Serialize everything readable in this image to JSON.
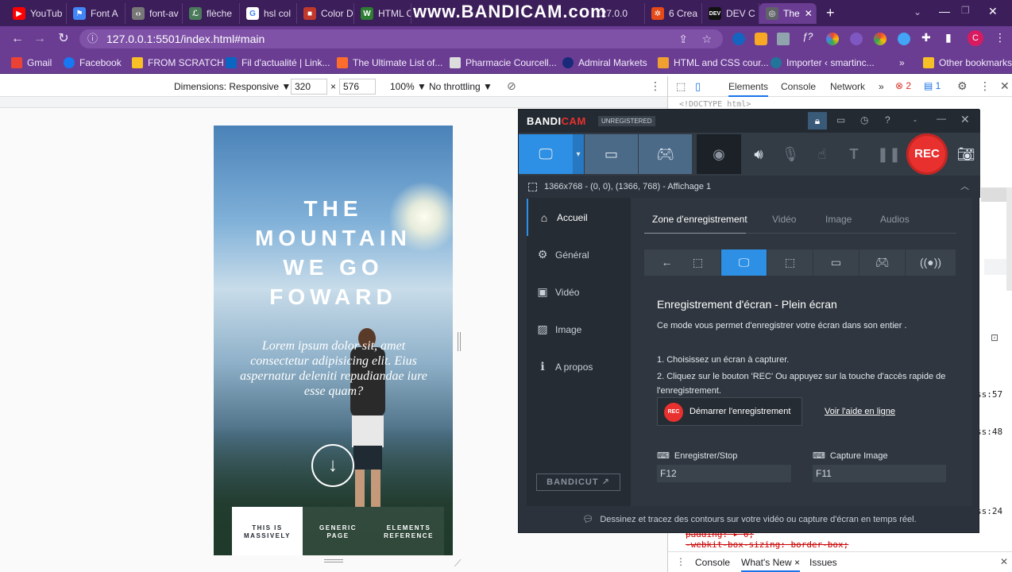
{
  "browser": {
    "tabs": [
      {
        "label": "YouTub",
        "color": "#ff0000",
        "glyph": "▶"
      },
      {
        "label": "Font A",
        "color": "#4285f4",
        "glyph": "⚑"
      },
      {
        "label": "font-av",
        "color": "#b0b0b0",
        "glyph": "‹›"
      },
      {
        "label": "flèche",
        "color": "#4a7a5a",
        "glyph": "ℒ"
      },
      {
        "label": "hsl col",
        "color": "#ffffff",
        "glyph": "G"
      },
      {
        "label": "Color D",
        "color": "#c0392b",
        "glyph": "■"
      },
      {
        "label": "HTML C",
        "color": "#2e7d32",
        "glyph": "W"
      },
      {
        "label": "127.0.0",
        "color": "#6a3d93",
        "glyph": "◷"
      },
      {
        "label": "6 Crea",
        "color": "#e64a19",
        "glyph": "✲"
      },
      {
        "label": "DEV C",
        "color": "#111111",
        "glyph": "DEV"
      },
      {
        "label": "The",
        "color": "#5f6368",
        "glyph": "◎"
      }
    ],
    "watermark": "www.BANDICAM.com",
    "url": "127.0.0.1:5501/index.html#main",
    "bookmarks": [
      {
        "label": "Gmail",
        "color": "#ea4335"
      },
      {
        "label": "Facebook",
        "color": "#1877f2"
      },
      {
        "label": "FROM SCRATCH",
        "color": "#f6c026"
      },
      {
        "label": "Fil d'actualité | Link...",
        "color": "#0a66c2"
      },
      {
        "label": "The Ultimate List of...",
        "color": "#ff6d2d"
      },
      {
        "label": "Pharmacie Courcell...",
        "color": "#dddddd"
      },
      {
        "label": "Admiral Markets",
        "color": "#1a2a7a"
      },
      {
        "label": "HTML and CSS cour...",
        "color": "#f0a030"
      },
      {
        "label": "Importer ‹ smartinc...",
        "color": "#21759b"
      }
    ],
    "bookmarks_more": "»",
    "other_bookmarks": "Other bookmarks",
    "profile_initial": "C"
  },
  "device_toolbar": {
    "dimensions_label": "Dimensions: Responsive ▼",
    "width": "320",
    "times": "×",
    "height": "576",
    "zoom": "100% ▼",
    "throttle": "No throttling ▼"
  },
  "site": {
    "title_lines": [
      "THE",
      "MOUNTAIN",
      "WE GO",
      "FOWARD"
    ],
    "lead": "Lorem ipsum dolor sit, amet consectetur adipisicing elit. Eius aspernatur deleniti repudiandae iure esse quam?",
    "scroll_arrow": "↓",
    "nav": [
      {
        "line1": "THIS IS",
        "line2": "MASSIVELY",
        "active": true
      },
      {
        "line1": "GENERIC",
        "line2": "PAGE",
        "active": false
      },
      {
        "line1": "ELEMENTS",
        "line2": "REFERENCE",
        "active": false
      }
    ]
  },
  "devtools": {
    "tabs": [
      "Elements",
      "Console",
      "Network"
    ],
    "more": "»",
    "errors": "2",
    "messages": "1",
    "doctype": "<!DOCTYPE html>",
    "line_refs": [
      "ss:57",
      "ss:48",
      "ss:24"
    ],
    "css_lines": [
      "padding: ▸ 0;",
      "-webkit-box-sizing: border-box;"
    ],
    "drawer_tabs": [
      "Console",
      "What's New ×",
      "Issues"
    ]
  },
  "bandicam": {
    "brand_a": "BANDI",
    "brand_b": "CAM",
    "unregistered": "UNREGISTERED",
    "rec_label": "REC",
    "info": "1366x768 - (0, 0), (1366, 768) - Affichage 1",
    "side": [
      {
        "label": "Accueil",
        "glyph": "⌂",
        "active": true
      },
      {
        "label": "Général",
        "glyph": "⚙",
        "active": false
      },
      {
        "label": "Vidéo",
        "glyph": "▣",
        "active": false
      },
      {
        "label": "Image",
        "glyph": "▨",
        "active": false
      },
      {
        "label": "A propos",
        "glyph": "ℹ",
        "active": false
      }
    ],
    "bandicut": "BANDICUT ↗",
    "content_tabs": [
      {
        "label": "Zone d'enregistrement",
        "active": true
      },
      {
        "label": "Vidéo",
        "active": false
      },
      {
        "label": "Image",
        "active": false
      },
      {
        "label": "Audios",
        "active": false
      }
    ],
    "heading": "Enregistrement d'écran - Plein écran",
    "description": "Ce mode vous permet d'enregistrer votre écran dans son entier .",
    "step1": "1. Choisissez un écran à capturer.",
    "step2": "2. Cliquez sur le bouton 'REC' Ou appuyez sur la touche d'accès rapide de l'enregistrement.",
    "start_rec_badge": "REC",
    "start_rec": "Démarrer l'enregistrement",
    "help_link": "Voir l'aide en ligne",
    "hotkey_record_label": "Enregistrer/Stop",
    "hotkey_record": "F12",
    "hotkey_capture_label": "Capture Image",
    "hotkey_capture": "F11",
    "footer": "Dessinez et tracez des contours sur votre vidéo ou capture d'écran en temps réel."
  },
  "colors": {
    "chrome_tab": "#3c1e5a",
    "chrome_toolbar": "#6a3d93",
    "bandicam_accent": "#2e90e5",
    "rec_red": "#e8312f"
  }
}
